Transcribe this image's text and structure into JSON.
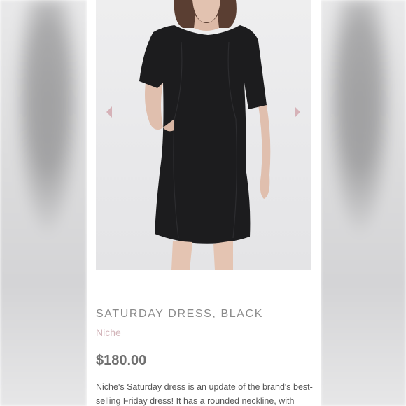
{
  "product": {
    "title": "SATURDAY DRESS, BLACK",
    "brand": "Niche",
    "price": "$180.00",
    "description": "Niche's Saturday dress is an update of the brand's best-selling Friday dress!  It has a rounded neckline, with"
  },
  "gallery": {
    "prev_icon": "chevron-left-icon",
    "next_icon": "chevron-right-icon",
    "arrow_color": "#d6b2b8"
  },
  "colors": {
    "title": "#8a8a8a",
    "brand": "#d3b5ba",
    "price": "#707070",
    "dress": "#1c1c1e"
  }
}
